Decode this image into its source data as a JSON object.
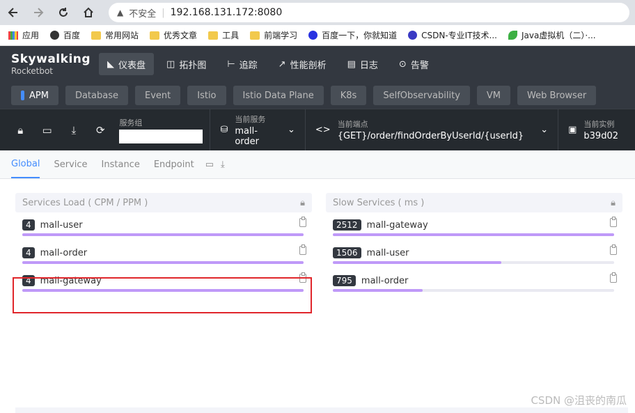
{
  "browser": {
    "insecure_label": "不安全",
    "url": "192.168.131.172:8080",
    "bookmarks": [
      {
        "label": "应用",
        "icon": "apps-icon"
      },
      {
        "label": "百度",
        "icon": "globe-icon"
      },
      {
        "label": "常用网站",
        "icon": "folder-icon"
      },
      {
        "label": "优秀文章",
        "icon": "folder-icon"
      },
      {
        "label": "工具",
        "icon": "folder-icon"
      },
      {
        "label": "前端学习",
        "icon": "folder-icon"
      },
      {
        "label": "百度一下，你就知道",
        "icon": "paw-icon"
      },
      {
        "label": "CSDN-专业IT技术...",
        "icon": "gear-icon"
      },
      {
        "label": "Java虚拟机（二）·...",
        "icon": "leaf-icon"
      }
    ]
  },
  "app": {
    "logo_line1": "Skywalking",
    "logo_line2": "Rocketbot",
    "nav": [
      "仪表盘",
      "拓扑图",
      "追踪",
      "性能剖析",
      "日志",
      "告警"
    ],
    "layers": [
      "APM",
      "Database",
      "Event",
      "Istio",
      "Istio Data Plane",
      "K8s",
      "SelfObservability",
      "VM",
      "Web Browser"
    ]
  },
  "toolbar": {
    "group_label": "服务组",
    "service_label": "当前服务",
    "service_value": "mall-order",
    "endpoint_label": "当前端点",
    "endpoint_value": "{GET}/order/findOrderByUserId/{userId}",
    "instance_label": "当前实例",
    "instance_value": "b39d02"
  },
  "tabs": [
    "Global",
    "Service",
    "Instance",
    "Endpoint"
  ],
  "services_load": {
    "title": "Services Load ( CPM / PPM )",
    "items": [
      {
        "value": "4",
        "name": "mall-user",
        "fill": 1.0
      },
      {
        "value": "4",
        "name": "mall-order",
        "fill": 1.0
      },
      {
        "value": "4",
        "name": "mall-gateway",
        "fill": 1.0
      }
    ]
  },
  "slow_services": {
    "title": "Slow Services ( ms )",
    "items": [
      {
        "value": "2512",
        "name": "mall-gateway",
        "fill": 1.0
      },
      {
        "value": "1506",
        "name": "mall-user",
        "fill": 0.6
      },
      {
        "value": "795",
        "name": "mall-order",
        "fill": 0.32
      }
    ]
  },
  "watermark": "CSDN @沮丧的南瓜",
  "colors": {
    "accent": "#448dfe",
    "bar": "#bf99f8",
    "highlight": "#e0262b",
    "header": "#333840"
  }
}
